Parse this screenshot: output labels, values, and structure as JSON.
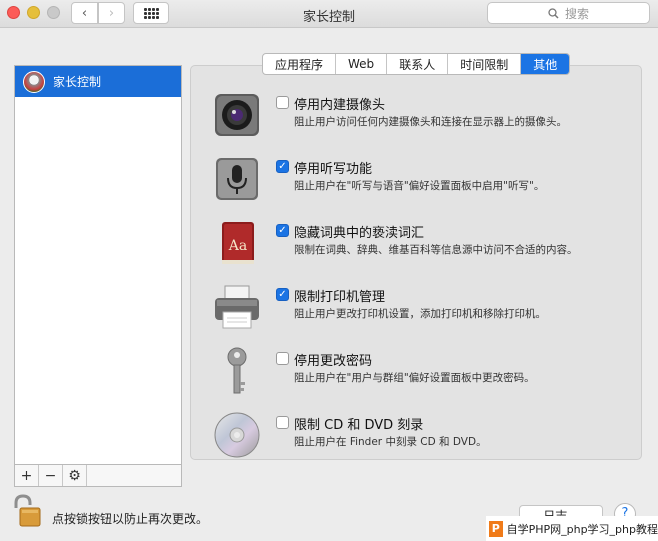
{
  "window": {
    "title": "家长控制"
  },
  "search": {
    "placeholder": "搜索"
  },
  "nav": {
    "back_glyph": "‹",
    "forward_glyph": "›"
  },
  "sidebar": {
    "items": [
      {
        "label": "家长控制",
        "icon": "parental-controls-avatar",
        "selected": true
      }
    ],
    "toolbar": {
      "add": "+",
      "remove": "−",
      "gear": "⚙"
    }
  },
  "tabs": [
    {
      "label": "应用程序",
      "active": false
    },
    {
      "label": "Web",
      "active": false
    },
    {
      "label": "联系人",
      "active": false
    },
    {
      "label": "时间限制",
      "active": false
    },
    {
      "label": "其他",
      "active": true
    }
  ],
  "options": [
    {
      "icon": "camera-icon",
      "checked": false,
      "title": "停用内建摄像头",
      "desc": "阻止用户访问任何内建摄像头和连接在显示器上的摄像头。"
    },
    {
      "icon": "microphone-icon",
      "checked": true,
      "title": "停用听写功能",
      "desc": "阻止用户在\"听写与语音\"偏好设置面板中启用\"听写\"。"
    },
    {
      "icon": "dictionary-icon",
      "checked": true,
      "title": "隐藏词典中的亵渎词汇",
      "desc": "限制在词典、辞典、维基百科等信息源中访问不合适的内容。"
    },
    {
      "icon": "printer-icon",
      "checked": true,
      "title": "限制打印机管理",
      "desc": "阻止用户更改打印机设置，添加打印机和移除打印机。"
    },
    {
      "icon": "key-icon",
      "checked": false,
      "title": "停用更改密码",
      "desc": "阻止用户在\"用户与群组\"偏好设置面板中更改密码。"
    },
    {
      "icon": "cd-icon",
      "checked": false,
      "title": "限制 CD 和 DVD 刻录",
      "desc": "阻止用户在 Finder 中刻录 CD 和 DVD。"
    }
  ],
  "footer": {
    "lock_text": "点按锁按钮以防止再次更改。",
    "log_button": "日志...",
    "help": "?",
    "watermark_logo": "P",
    "watermark_text": "自学PHP网_php学习_php教程"
  },
  "colors": {
    "accent": "#1b74e4",
    "selection": "#1b6ed8"
  }
}
